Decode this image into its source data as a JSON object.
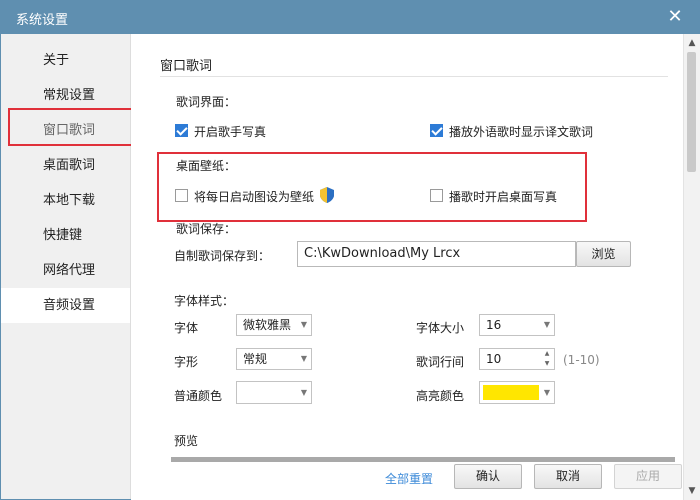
{
  "window": {
    "title": "系统设置",
    "close_glyph": "✕"
  },
  "sidebar": {
    "items": [
      {
        "label": "关于"
      },
      {
        "label": "常规设置"
      },
      {
        "label": "窗口歌词"
      },
      {
        "label": "桌面歌词"
      },
      {
        "label": "本地下载"
      },
      {
        "label": "快捷键"
      },
      {
        "label": "网络代理"
      },
      {
        "label": "音频设置"
      }
    ],
    "highlighted_item": "窗口歌词",
    "selected_item": "音频设置"
  },
  "content": {
    "section_title": "窗口歌词",
    "lyrics_ui": {
      "label": "歌词界面：",
      "options": [
        {
          "label": "开启歌手写真",
          "checked": true
        },
        {
          "label": "播放外语歌时显示译文歌词",
          "checked": true
        }
      ]
    },
    "wallpaper": {
      "label": "桌面壁纸：",
      "options": [
        {
          "label": "将每日启动图设为壁纸",
          "checked": false,
          "icon": "shield-icon"
        },
        {
          "label": "播歌时开启桌面写真",
          "checked": false
        }
      ]
    },
    "save": {
      "label": "歌词保存：",
      "path_label": "自制歌词保存到：",
      "path_value": "C:\\KwDownload\\My Lrcx",
      "browse_label": "浏览"
    },
    "font": {
      "label": "字体样式：",
      "font_label": "字体",
      "font_value": "微软雅黑",
      "size_label": "字体大小",
      "size_value": "16",
      "style_label": "字形",
      "style_value": "常规",
      "spacing_label": "歌词行间",
      "spacing_value": "10",
      "spacing_range": "(1-10)",
      "normal_color_label": "普通颜色",
      "normal_color": "#ffffff",
      "highlight_color_label": "高亮颜色",
      "highlight_color": "#ffe600"
    },
    "preview_label": "预览"
  },
  "footer": {
    "reset_label": "全部重置",
    "ok_label": "确认",
    "cancel_label": "取消",
    "apply_label": "应用"
  },
  "colors": {
    "titlebar": "#5f8fb0",
    "highlight_box": "#e0303a",
    "link": "#3c8ad8"
  }
}
